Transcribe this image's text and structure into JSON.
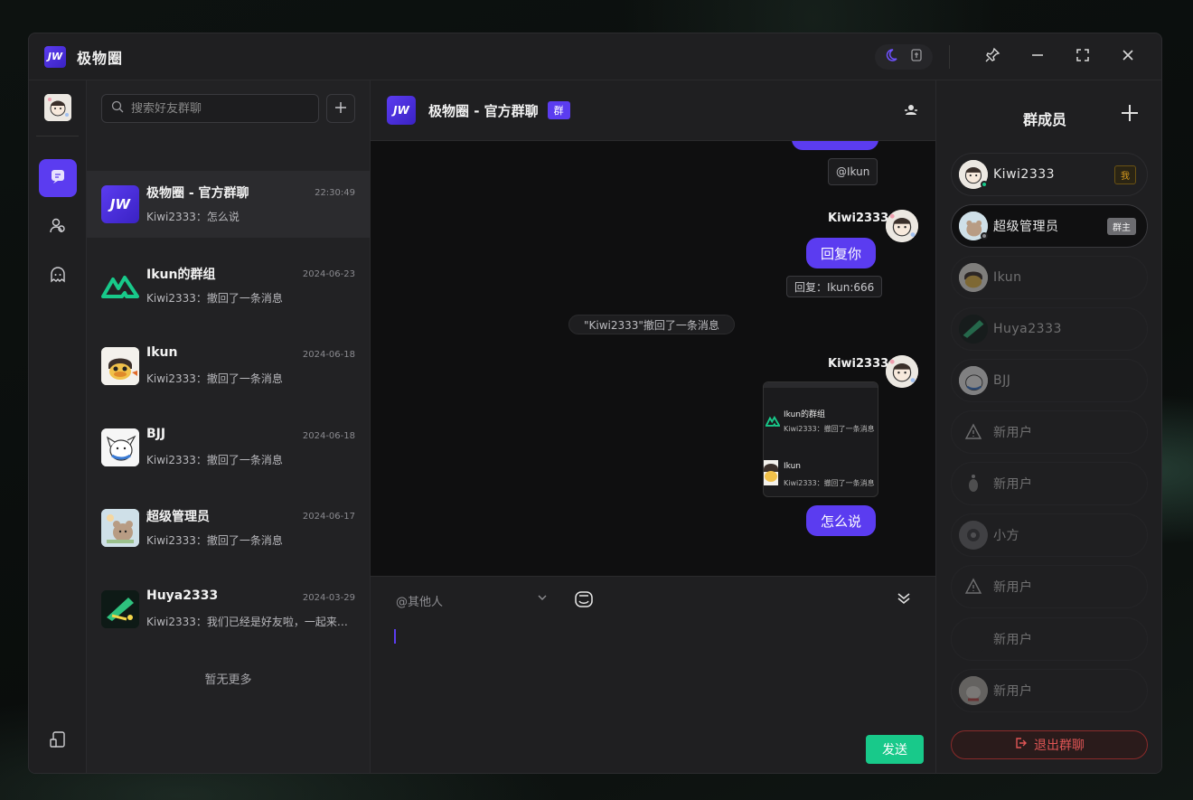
{
  "app": {
    "title": "极物圈",
    "logo_text": "JW"
  },
  "titlebar": {
    "theme_icons": [
      "moon-icon",
      "layout-icon"
    ],
    "buttons": [
      "pin-icon",
      "minimize-icon",
      "maximize-icon",
      "close-icon"
    ]
  },
  "search": {
    "placeholder": "搜索好友群聊"
  },
  "conversations": [
    {
      "name": "极物圈 - 官方群聊",
      "time": "22:30:49",
      "msg": "Kiwi2333：怎么说"
    },
    {
      "name": "Ikun的群组",
      "time": "2024-06-23",
      "msg": "Kiwi2333：撤回了一条消息"
    },
    {
      "name": "Ikun",
      "time": "2024-06-18",
      "msg": "Kiwi2333：撤回了一条消息"
    },
    {
      "name": "BJJ",
      "time": "2024-06-18",
      "msg": "Kiwi2333：撤回了一条消息"
    },
    {
      "name": "超级管理员",
      "time": "2024-06-17",
      "msg": "Kiwi2333：撤回了一条消息"
    },
    {
      "name": "Huya2333",
      "time": "2024-03-29",
      "msg": "Kiwi2333：我们已经是好友啦，一起来聊..."
    }
  ],
  "no_more": "暂无更多",
  "chat": {
    "title": "极物圈 - 官方群聊",
    "tag": "群",
    "quote_top": "@Ikun",
    "sender1": "Kiwi2333",
    "bubble1": "回复你",
    "quote1": "回复：Ikun:666",
    "system_note": "\"Kiwi2333\"撤回了一条消息",
    "sender2": "Kiwi2333",
    "card": [
      {
        "name": "Ikun的群组",
        "msg": "Kiwi2333：撤回了一条消息"
      },
      {
        "name": "Ikun",
        "msg": "Kiwi2333：撤回了一条消息"
      }
    ],
    "bubble2": "怎么说"
  },
  "composer": {
    "mention_placeholder": "@其他人",
    "send_label": "发送"
  },
  "members": {
    "title": "群成员",
    "list": [
      {
        "name": "Kiwi2333",
        "badge": "我"
      },
      {
        "name": "超级管理员",
        "badge": "群主"
      },
      {
        "name": "Ikun"
      },
      {
        "name": "Huya2333"
      },
      {
        "name": "BJJ"
      },
      {
        "name": "新用户"
      },
      {
        "name": "新用户"
      },
      {
        "name": "小方"
      },
      {
        "name": "新用户"
      },
      {
        "name": "新用户"
      },
      {
        "name": "新用户"
      }
    ],
    "leave_label": "退出群聊"
  },
  "colors": {
    "accent": "#5b3cf0",
    "send": "#18c98a",
    "danger": "#e05555"
  }
}
